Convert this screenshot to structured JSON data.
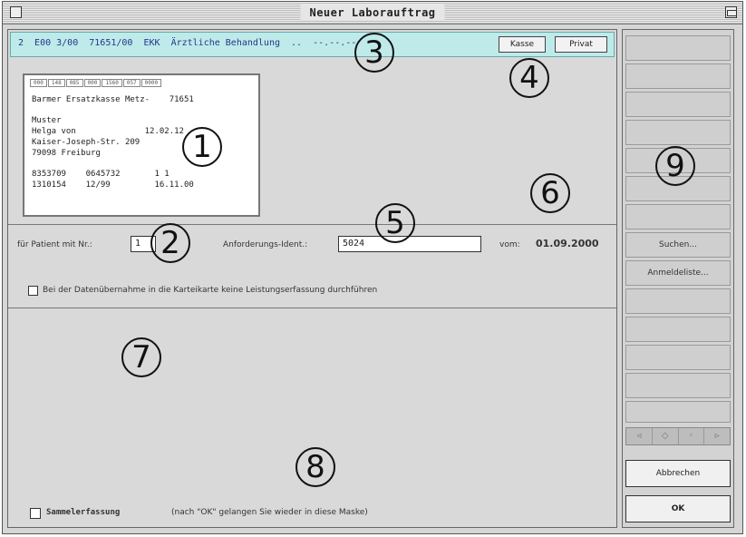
{
  "window": {
    "title": "Neuer Laborauftrag"
  },
  "header": {
    "info_text": "2  E00 3/00  71651/00  EKK  Ärztliche Behandlung  ..  --.--.--",
    "kasse_label": "Kasse",
    "privat_label": "Privat"
  },
  "card": {
    "head_cells": [
      "000",
      "148",
      "085",
      "000",
      "1560",
      "057",
      "0000"
    ],
    "lines": [
      "Barmer Ersatzkasse Metz-    71651",
      "",
      "Muster",
      "Helga von              12.02.12",
      "Kaiser-Joseph-Str. 209",
      "79098 Freiburg",
      "",
      "8353709    0645732       1 1",
      "1310154    12/99         16.11.00"
    ]
  },
  "form": {
    "patient_label": "für Patient mit Nr.:",
    "patient_value": "1",
    "request_label": "Anforderungs-Ident.:",
    "request_value": "5024",
    "date_label": "vom:",
    "date_value": "01.09.2000",
    "transfer_checkbox_label": "Bei der Datenübernahme in die Karteikarte keine Leistungserfassung durchführen",
    "sammel_label": "Sammelerfassung",
    "sammel_hint": "(nach \"OK\" gelangen Sie wieder in diese Maske)"
  },
  "callouts": [
    "1",
    "2",
    "3",
    "4",
    "5",
    "6",
    "7",
    "8",
    "9"
  ],
  "sidebar": {
    "suchen_label": "Suchen...",
    "anmeldeliste_label": "Anmeldeliste...",
    "nav_icons": [
      "first-icon",
      "prev-icon",
      "next-icon",
      "last-icon"
    ],
    "nav_glyphs": [
      "◃",
      "◇",
      "◦",
      "▹"
    ],
    "cancel_label": "Abbrechen",
    "ok_label": "OK"
  },
  "colors": {
    "header_bg": "#bfeaea",
    "header_text": "#1e3a8a"
  }
}
